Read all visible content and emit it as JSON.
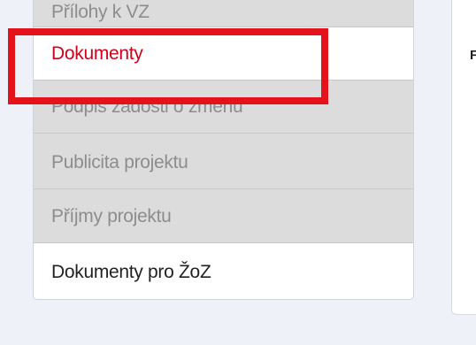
{
  "nav": {
    "items": [
      {
        "label": "Přílohy k VZ",
        "state": "disabled"
      },
      {
        "label": "Dokumenty",
        "state": "active"
      },
      {
        "label": "Podpis žádosti o změnu",
        "state": "disabled"
      },
      {
        "label": "Publicita projektu",
        "state": "disabled"
      },
      {
        "label": "Příjmy projektu",
        "state": "disabled"
      },
      {
        "label": "Dokumenty pro ŽoZ",
        "state": "normal"
      }
    ]
  },
  "content": {
    "label_fragment": "F"
  },
  "colors": {
    "active_text": "#d0021b",
    "highlight": "#e4121b",
    "disabled_bg": "#dcdcdc",
    "page_bg": "#eef1f8"
  }
}
